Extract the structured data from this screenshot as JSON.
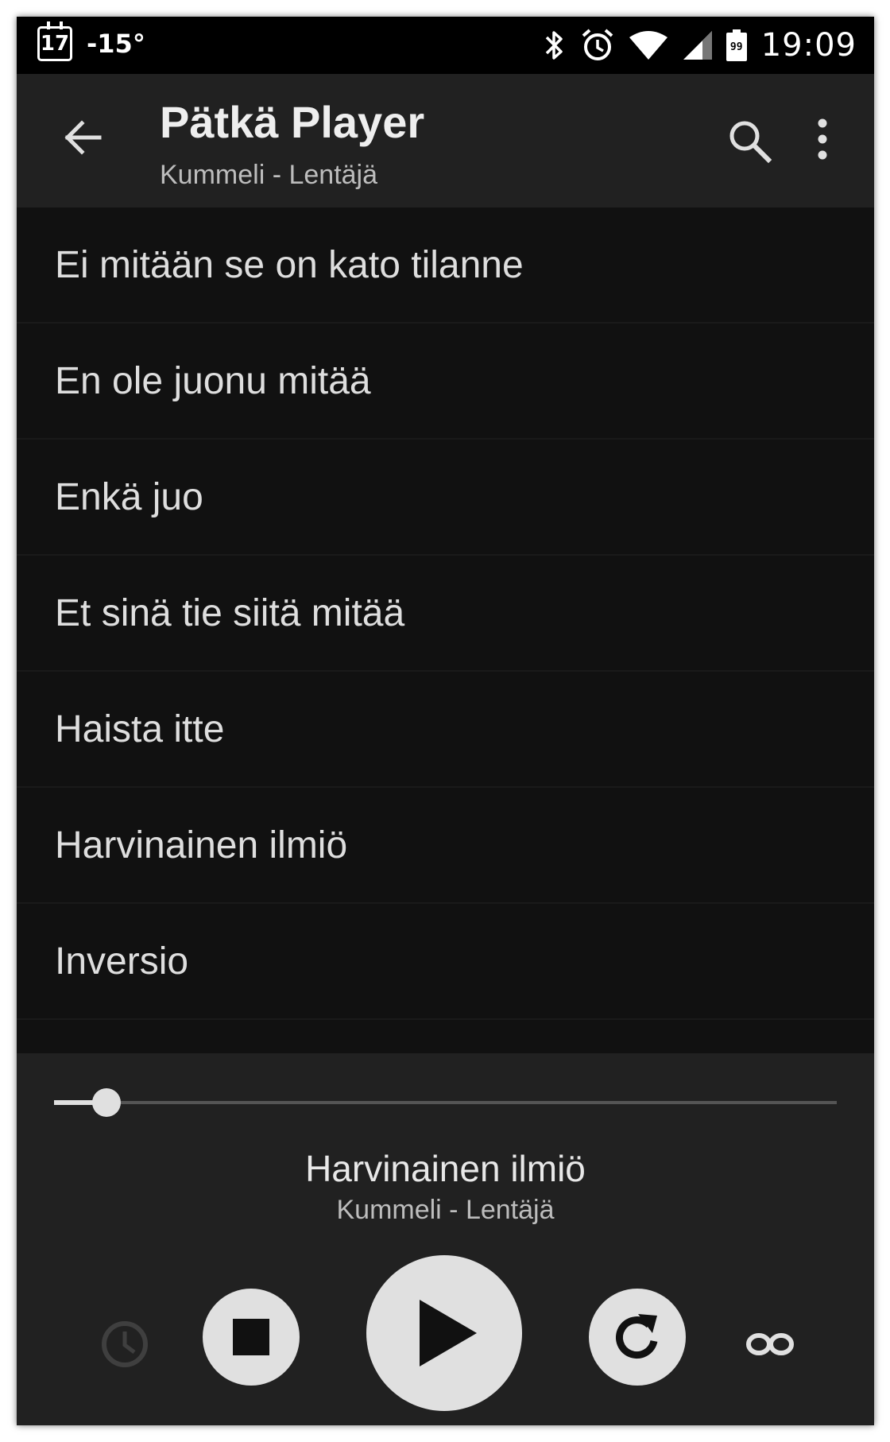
{
  "status_bar": {
    "calendar_day": "17",
    "temperature": "-15°",
    "time": "19:09",
    "battery_level": "99",
    "icons": [
      "calendar-icon",
      "bluetooth-icon",
      "alarm-icon",
      "wifi-icon",
      "cellular-signal-icon",
      "battery-icon"
    ]
  },
  "app_bar": {
    "title": "Pätkä Player",
    "subtitle": "Kummeli - Lentäjä",
    "icons": [
      "back-arrow-icon",
      "search-icon",
      "more-vert-icon"
    ]
  },
  "tracks": [
    "Ei mitään se on kato tilanne",
    "En ole juonu mitää",
    "Enkä juo",
    "Et sinä tie siitä mitää",
    "Haista itte",
    "Harvinainen ilmiö",
    "Inversio"
  ],
  "player": {
    "now_playing_title": "Harvinainen ilmiö",
    "now_playing_subtitle": "Kummeli - Lentäjä",
    "progress_percent": 6.7,
    "controls": [
      "sleep-timer-icon",
      "stop-icon",
      "play-icon",
      "replay-icon",
      "loop-icon"
    ]
  },
  "colors": {
    "status_bar_bg": "#000000",
    "app_bar_bg": "#212121",
    "list_bg": "#111111",
    "player_bg": "#212121",
    "control_fill": "#e0e0e0",
    "text_primary": "#dedede",
    "text_secondary": "#bdbdbd"
  }
}
